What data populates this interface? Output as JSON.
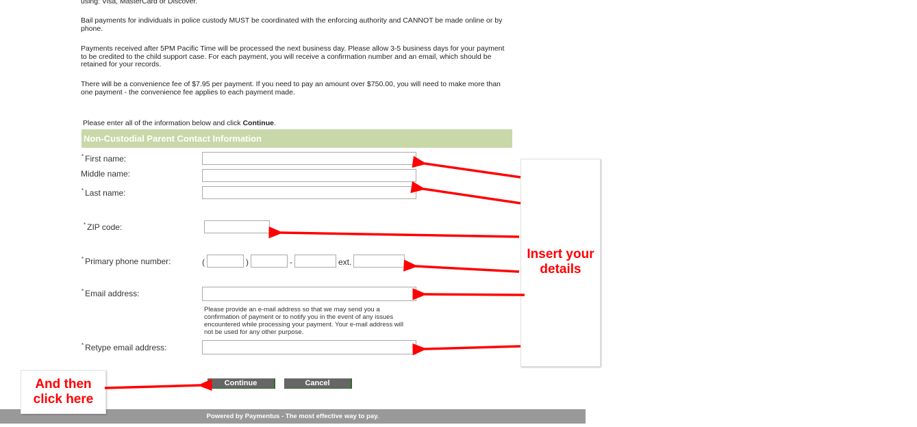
{
  "paragraphs": [
    "using: Visa, MasterCard or Discover.",
    "Bail payments for individuals in police custody MUST be coordinated with the enforcing authority and CANNOT be made online or by phone.",
    "Payments received after 5PM Pacific Time will be processed the next business day. Please allow 3-5 business days for your payment to be credited to the child support case. For each payment, you will receive a confirmation number and an email, which should be retained for your records.",
    "There will be a convenience fee of $7.95 per payment. If you need to pay an amount over $750.00, you will need to make more than one payment - the convenience fee applies to each payment made."
  ],
  "intro": {
    "text": "Please enter all of the information below and click ",
    "bold": "Continue",
    "end": "."
  },
  "section_title": "Non-Custodial Parent Contact Information",
  "required_marker": "*",
  "form": {
    "first_name": {
      "label": "First name:",
      "value": ""
    },
    "middle_name": {
      "label": "Middle name:",
      "value": ""
    },
    "last_name": {
      "label": "Last name:",
      "value": ""
    },
    "zip": {
      "label": "ZIP code:",
      "value": ""
    },
    "phone": {
      "label": "Primary phone number:",
      "open_paren": "(",
      "close_paren": ")",
      "dash": "-",
      "ext_label": "ext.",
      "area": "",
      "prefix": "",
      "line": "",
      "ext": ""
    },
    "email": {
      "label": "Email address:",
      "value": ""
    },
    "email_note": "Please provide an e-mail address so that we may send you a confirmation of payment or to notify you in the event of any issues encountered while processing your payment. Your e-mail address will not be used for any other purpose.",
    "retype_email": {
      "label": "Retype email address:",
      "value": ""
    }
  },
  "buttons": {
    "continue": "Continue",
    "cancel": "Cancel"
  },
  "footer": "Powered by Paymentus - The most effective way to pay.",
  "annotations": {
    "insert_details": "Insert your details",
    "click_here": "And then click here",
    "color": "#ff0000"
  },
  "colors": {
    "section_header_bg": "#c8d8a8",
    "button_bg": "#666666",
    "footer_bg": "#999999"
  }
}
